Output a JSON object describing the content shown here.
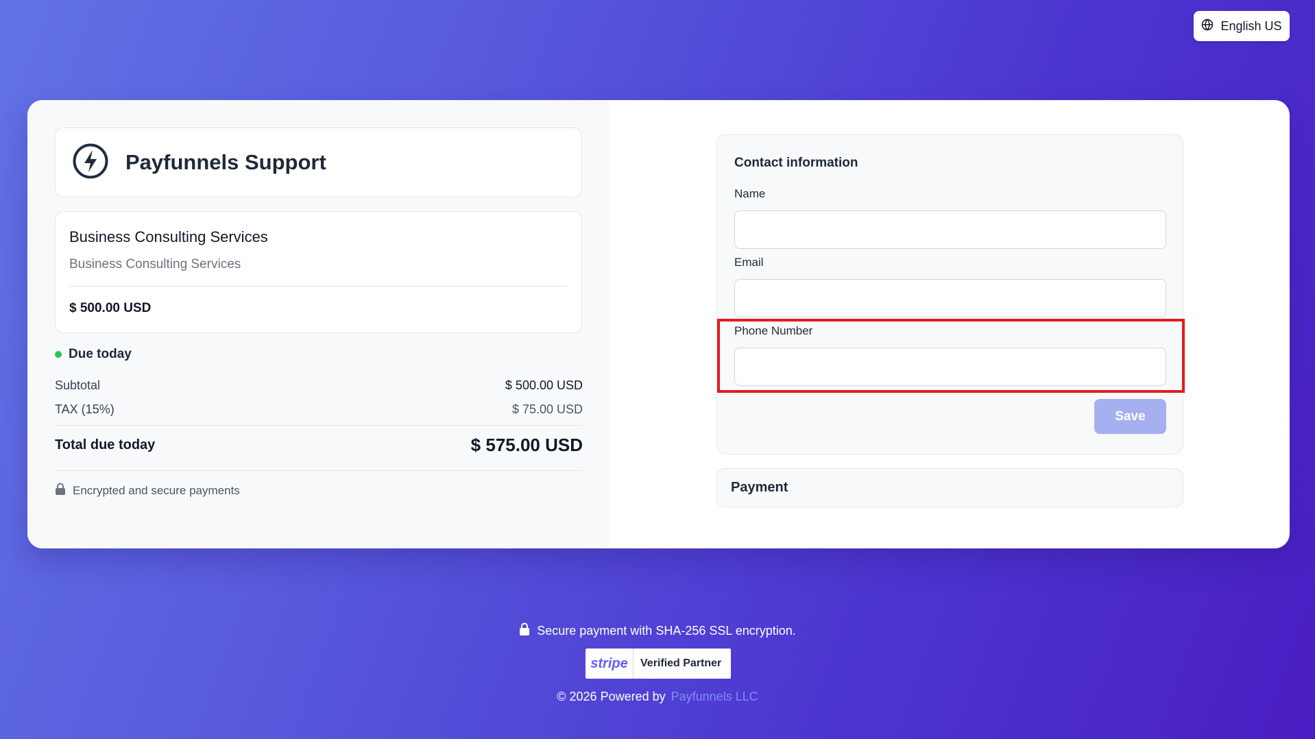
{
  "language": {
    "label": "English US",
    "icon": "globe-icon"
  },
  "brand": {
    "name": "Payfunnels Support",
    "icon": "lightning-bolt-icon"
  },
  "product": {
    "name": "Business Consulting Services",
    "description": "Business Consulting Services",
    "price": "$ 500.00 USD"
  },
  "summary": {
    "due_label": "Due today",
    "subtotal_label": "Subtotal",
    "subtotal_value": "$ 500.00 USD",
    "tax_label": "TAX (15%)",
    "tax_value": "$ 75.00 USD",
    "total_label": "Total due today",
    "total_value": "$ 575.00 USD",
    "secure_note": "Encrypted and secure payments"
  },
  "contact": {
    "title": "Contact information",
    "name_label": "Name",
    "name_value": "",
    "email_label": "Email",
    "email_value": "",
    "phone_label": "Phone Number",
    "phone_value": "",
    "save_label": "Save"
  },
  "payment": {
    "title": "Payment"
  },
  "footer": {
    "secure_text": "Secure payment with SHA-256 SSL encryption.",
    "stripe_logo": "stripe",
    "stripe_badge": "Verified Partner",
    "copyright": "© 2026 Powered by",
    "company_link": "Payfunnels LLC"
  },
  "colors": {
    "accent": "#635bff",
    "due_dot": "#22c55e",
    "highlight": "#e11d1d",
    "save_disabled": "#a5b0f0"
  }
}
